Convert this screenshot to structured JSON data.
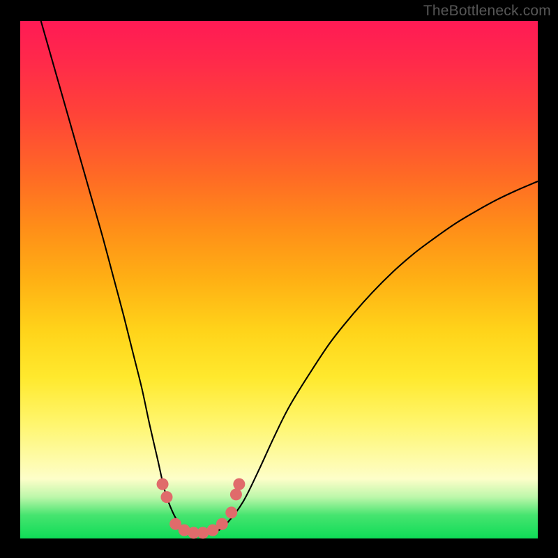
{
  "watermark": "TheBottleneck.com",
  "chart_data": {
    "type": "line",
    "title": "",
    "xlabel": "",
    "ylabel": "",
    "xlim": [
      0,
      100
    ],
    "ylim": [
      0,
      100
    ],
    "series": [
      {
        "name": "bottleneck-curve",
        "x": [
          4,
          6,
          8,
          10,
          12,
          14,
          16,
          18,
          20,
          22,
          23.5,
          25,
          26.5,
          28,
          29.5,
          31,
          32.5,
          34,
          36,
          38,
          40,
          43,
          46,
          49,
          52,
          56,
          60,
          64,
          68,
          72,
          76,
          80,
          84,
          88,
          92,
          96,
          100
        ],
        "y": [
          100,
          93,
          86,
          79,
          72,
          65,
          58,
          50.5,
          43,
          35,
          29,
          22,
          15.5,
          9,
          5,
          2.5,
          1.2,
          1,
          1,
          1.4,
          3,
          7,
          13,
          19.5,
          25.5,
          32,
          38,
          43,
          47.5,
          51.5,
          55,
          58,
          60.8,
          63.2,
          65.4,
          67.3,
          69
        ]
      }
    ],
    "markers": {
      "name": "highlight-points",
      "color": "#e06b6b",
      "points": [
        {
          "x": 27.5,
          "y": 10.5
        },
        {
          "x": 28.3,
          "y": 8.0
        },
        {
          "x": 30.0,
          "y": 2.8
        },
        {
          "x": 31.7,
          "y": 1.6
        },
        {
          "x": 33.5,
          "y": 1.1
        },
        {
          "x": 35.3,
          "y": 1.1
        },
        {
          "x": 37.2,
          "y": 1.6
        },
        {
          "x": 39.0,
          "y": 2.8
        },
        {
          "x": 40.8,
          "y": 5.0
        },
        {
          "x": 41.7,
          "y": 8.5
        },
        {
          "x": 42.3,
          "y": 10.5
        }
      ]
    },
    "grid": false,
    "legend": false
  }
}
